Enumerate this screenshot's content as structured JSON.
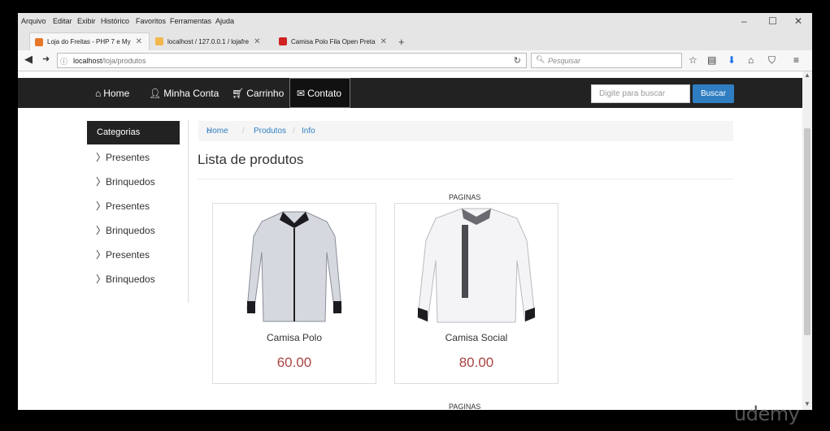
{
  "browser": {
    "menu": [
      "Arquivo",
      "Editar",
      "Exibir",
      "Histórico",
      "Favoritos",
      "Ferramentas",
      "Ajuda"
    ],
    "tabs": [
      {
        "label": "Loja do Freitas - PHP 7 e My",
        "active": true
      },
      {
        "label": "localhost / 127.0.0.1 / lojafre",
        "active": false
      },
      {
        "label": "Camisa Polo Fila Open Preta",
        "active": false
      }
    ],
    "new_tab": "+",
    "url_host": "localhost",
    "url_path": "/loja/produtos",
    "search_placeholder": "Pesquisar"
  },
  "site": {
    "nav": [
      {
        "label": "Home",
        "icon": "home-icon"
      },
      {
        "label": "Minha Conta",
        "icon": "user-icon"
      },
      {
        "label": "Carrinho",
        "icon": "cart-icon"
      },
      {
        "label": "Contato",
        "icon": "envelope-icon"
      }
    ],
    "search_placeholder": "Digite para buscar",
    "search_button": "Buscar"
  },
  "sidebar": {
    "title": "Categorias",
    "items": [
      "Presentes",
      "Brinquedos",
      "Presentes",
      "Brinquedos",
      "Presentes",
      "Brinquedos"
    ]
  },
  "breadcrumb": [
    "Home",
    "Produtos",
    "Info"
  ],
  "main": {
    "title": "Lista de produtos",
    "pagination_label": "PAGINAS",
    "products": [
      {
        "name": "Camisa Polo",
        "price": "60.00"
      },
      {
        "name": "Camisa Social",
        "price": "80.00"
      }
    ]
  },
  "watermark": "udemy",
  "colors": {
    "navbar": "#222222",
    "accent": "#2f7ec1",
    "price": "#a94442"
  }
}
